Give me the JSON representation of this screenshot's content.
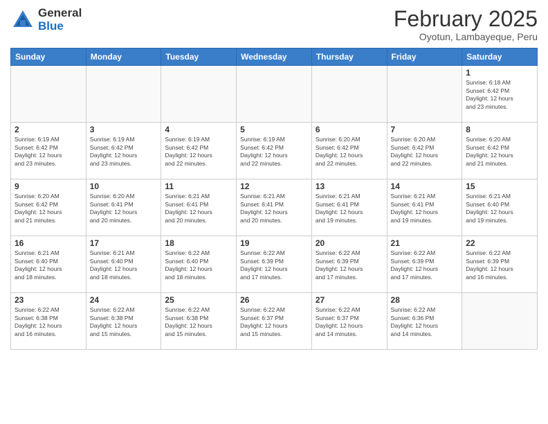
{
  "header": {
    "logo_general": "General",
    "logo_blue": "Blue",
    "month_year": "February 2025",
    "location": "Oyotun, Lambayeque, Peru"
  },
  "weekdays": [
    "Sunday",
    "Monday",
    "Tuesday",
    "Wednesday",
    "Thursday",
    "Friday",
    "Saturday"
  ],
  "weeks": [
    [
      {
        "day": "",
        "info": ""
      },
      {
        "day": "",
        "info": ""
      },
      {
        "day": "",
        "info": ""
      },
      {
        "day": "",
        "info": ""
      },
      {
        "day": "",
        "info": ""
      },
      {
        "day": "",
        "info": ""
      },
      {
        "day": "1",
        "info": "Sunrise: 6:18 AM\nSunset: 6:42 PM\nDaylight: 12 hours\nand 23 minutes."
      }
    ],
    [
      {
        "day": "2",
        "info": "Sunrise: 6:19 AM\nSunset: 6:42 PM\nDaylight: 12 hours\nand 23 minutes."
      },
      {
        "day": "3",
        "info": "Sunrise: 6:19 AM\nSunset: 6:42 PM\nDaylight: 12 hours\nand 23 minutes."
      },
      {
        "day": "4",
        "info": "Sunrise: 6:19 AM\nSunset: 6:42 PM\nDaylight: 12 hours\nand 22 minutes."
      },
      {
        "day": "5",
        "info": "Sunrise: 6:19 AM\nSunset: 6:42 PM\nDaylight: 12 hours\nand 22 minutes."
      },
      {
        "day": "6",
        "info": "Sunrise: 6:20 AM\nSunset: 6:42 PM\nDaylight: 12 hours\nand 22 minutes."
      },
      {
        "day": "7",
        "info": "Sunrise: 6:20 AM\nSunset: 6:42 PM\nDaylight: 12 hours\nand 22 minutes."
      },
      {
        "day": "8",
        "info": "Sunrise: 6:20 AM\nSunset: 6:42 PM\nDaylight: 12 hours\nand 21 minutes."
      }
    ],
    [
      {
        "day": "9",
        "info": "Sunrise: 6:20 AM\nSunset: 6:42 PM\nDaylight: 12 hours\nand 21 minutes."
      },
      {
        "day": "10",
        "info": "Sunrise: 6:20 AM\nSunset: 6:41 PM\nDaylight: 12 hours\nand 20 minutes."
      },
      {
        "day": "11",
        "info": "Sunrise: 6:21 AM\nSunset: 6:41 PM\nDaylight: 12 hours\nand 20 minutes."
      },
      {
        "day": "12",
        "info": "Sunrise: 6:21 AM\nSunset: 6:41 PM\nDaylight: 12 hours\nand 20 minutes."
      },
      {
        "day": "13",
        "info": "Sunrise: 6:21 AM\nSunset: 6:41 PM\nDaylight: 12 hours\nand 19 minutes."
      },
      {
        "day": "14",
        "info": "Sunrise: 6:21 AM\nSunset: 6:41 PM\nDaylight: 12 hours\nand 19 minutes."
      },
      {
        "day": "15",
        "info": "Sunrise: 6:21 AM\nSunset: 6:40 PM\nDaylight: 12 hours\nand 19 minutes."
      }
    ],
    [
      {
        "day": "16",
        "info": "Sunrise: 6:21 AM\nSunset: 6:40 PM\nDaylight: 12 hours\nand 18 minutes."
      },
      {
        "day": "17",
        "info": "Sunrise: 6:21 AM\nSunset: 6:40 PM\nDaylight: 12 hours\nand 18 minutes."
      },
      {
        "day": "18",
        "info": "Sunrise: 6:22 AM\nSunset: 6:40 PM\nDaylight: 12 hours\nand 18 minutes."
      },
      {
        "day": "19",
        "info": "Sunrise: 6:22 AM\nSunset: 6:39 PM\nDaylight: 12 hours\nand 17 minutes."
      },
      {
        "day": "20",
        "info": "Sunrise: 6:22 AM\nSunset: 6:39 PM\nDaylight: 12 hours\nand 17 minutes."
      },
      {
        "day": "21",
        "info": "Sunrise: 6:22 AM\nSunset: 6:39 PM\nDaylight: 12 hours\nand 17 minutes."
      },
      {
        "day": "22",
        "info": "Sunrise: 6:22 AM\nSunset: 6:39 PM\nDaylight: 12 hours\nand 16 minutes."
      }
    ],
    [
      {
        "day": "23",
        "info": "Sunrise: 6:22 AM\nSunset: 6:38 PM\nDaylight: 12 hours\nand 16 minutes."
      },
      {
        "day": "24",
        "info": "Sunrise: 6:22 AM\nSunset: 6:38 PM\nDaylight: 12 hours\nand 15 minutes."
      },
      {
        "day": "25",
        "info": "Sunrise: 6:22 AM\nSunset: 6:38 PM\nDaylight: 12 hours\nand 15 minutes."
      },
      {
        "day": "26",
        "info": "Sunrise: 6:22 AM\nSunset: 6:37 PM\nDaylight: 12 hours\nand 15 minutes."
      },
      {
        "day": "27",
        "info": "Sunrise: 6:22 AM\nSunset: 6:37 PM\nDaylight: 12 hours\nand 14 minutes."
      },
      {
        "day": "28",
        "info": "Sunrise: 6:22 AM\nSunset: 6:36 PM\nDaylight: 12 hours\nand 14 minutes."
      },
      {
        "day": "",
        "info": ""
      }
    ]
  ]
}
